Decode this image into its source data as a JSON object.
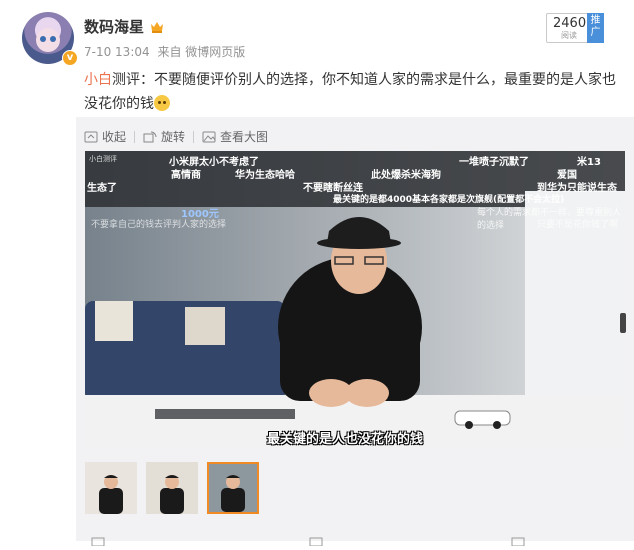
{
  "author": {
    "name": "数码海星",
    "timestamp": "7-10 13:04",
    "source": "来自 微博网页版",
    "verified_badge": "v"
  },
  "stats": {
    "read_count": "2460",
    "read_label": "阅读",
    "promote_label": "推广"
  },
  "post": {
    "mention": "小白",
    "body": "测评：不要随便评价别人的选择，你不知道人家的需求是什么，最重要的是人家也没花你的钱"
  },
  "toolbar": {
    "collapse": "收起",
    "rotate": "旋转",
    "view_large": "查看大图"
  },
  "video": {
    "channel": "小白测评",
    "corner_logo": "1000元",
    "subtitle": "最关键的是人也没花你的钱",
    "danmaku": [
      "小米屏太小不考虑了",
      "一堆喷子沉默了",
      "米13",
      "高情商",
      "华为生态哈哈",
      "此处爆杀米海狗",
      "爱国",
      "生态了",
      "不要瞎断丝连",
      "到华为只能说生态",
      "最关键的是都4000基本各家都是次旗舰(配置都不会太拉)",
      "每个人的需求都不一样，要尊重别人的选择",
      "不要拿自己的钱去评判人家的选择",
      "只要不是花你钱了啊"
    ]
  },
  "colors": {
    "mention": "#eb7350",
    "link_blue": "#4a8fd9",
    "thumb_active": "#f08a24"
  }
}
